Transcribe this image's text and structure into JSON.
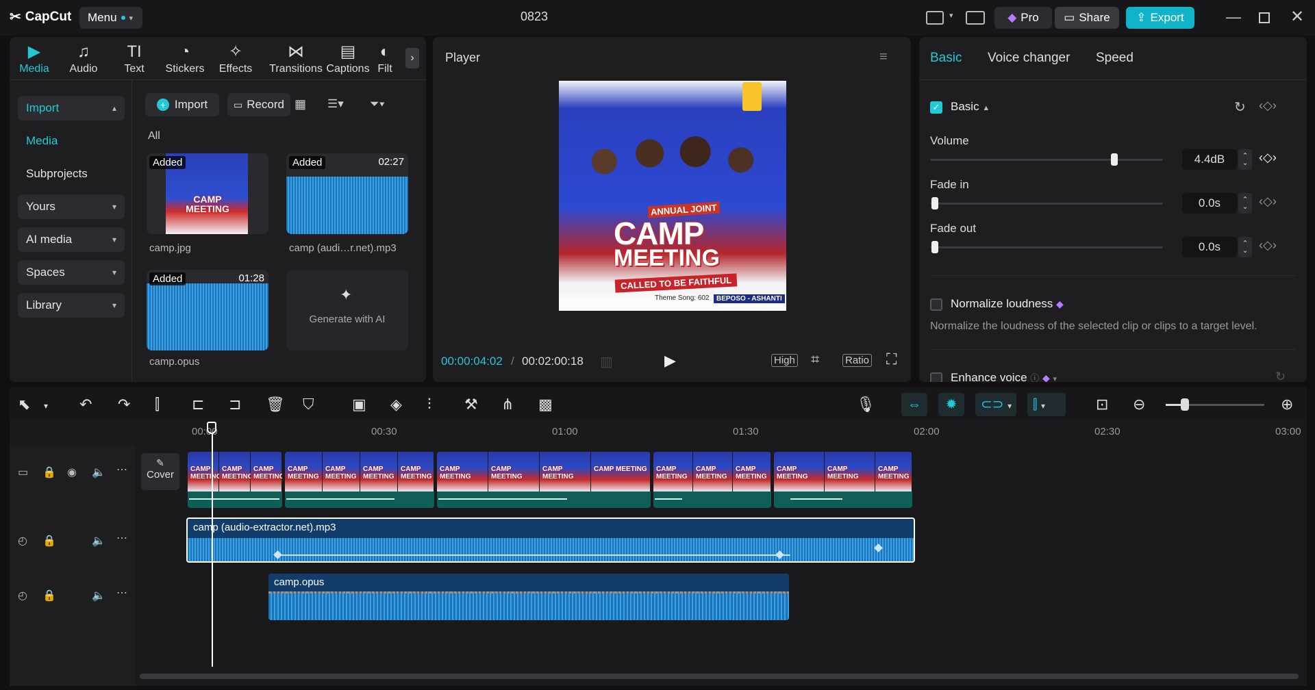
{
  "titlebar": {
    "logo": "CapCut",
    "menu": "Menu",
    "project": "0823",
    "pro": "Pro",
    "share": "Share",
    "export": "Export"
  },
  "media_tabs": [
    {
      "label": "Media",
      "icon": "media-icon"
    },
    {
      "label": "Audio",
      "icon": "audio-icon"
    },
    {
      "label": "Text",
      "icon": "text-icon"
    },
    {
      "label": "Stickers",
      "icon": "sticker-icon"
    },
    {
      "label": "Effects",
      "icon": "effects-icon"
    },
    {
      "label": "Transitions",
      "icon": "transition-icon"
    },
    {
      "label": "Captions",
      "icon": "captions-icon"
    },
    {
      "label": "Filt",
      "icon": "filter-icon"
    }
  ],
  "sidebar": {
    "import": "Import",
    "media": "Media",
    "subprojects": "Subprojects",
    "yours": "Yours",
    "ai_media": "AI media",
    "spaces": "Spaces",
    "library": "Library"
  },
  "media_toolbar": {
    "import": "Import",
    "record": "Record",
    "filter_all": "All"
  },
  "media_items": [
    {
      "name": "camp.jpg",
      "badge": "Added",
      "duration": ""
    },
    {
      "name": "camp (audi…r.net).mp3",
      "badge": "Added",
      "duration": "02:27"
    },
    {
      "name": "camp.opus",
      "badge": "Added",
      "duration": "01:28"
    }
  ],
  "generate_ai": "Generate with AI",
  "player": {
    "title": "Player",
    "current_time": "00:00:04:02",
    "total_time": "00:02:00:18",
    "quality": "High",
    "ratio": "Ratio",
    "poster": {
      "line1": "ANNUAL JOINT",
      "line2": "CAMP",
      "line3": "MEETING",
      "line4": "CALLED TO BE FAITHFUL",
      "theme": "Theme Song: 602",
      "place": "BEPOSO - ASHANTI"
    }
  },
  "inspector": {
    "tabs": [
      "Basic",
      "Voice changer",
      "Speed"
    ],
    "section": "Basic",
    "volume_label": "Volume",
    "volume_value": "4.4dB",
    "volume_level": 0.79,
    "fade_in_label": "Fade in",
    "fade_in_value": "0.0s",
    "fade_out_label": "Fade out",
    "fade_out_value": "0.0s",
    "normalize_label": "Normalize loudness",
    "normalize_desc": "Normalize the loudness of the selected clip or clips to a target level.",
    "enhance_label": "Enhance voice"
  },
  "timeline": {
    "ruler": [
      "00:00",
      "00:30",
      "01:00",
      "01:30",
      "02:00",
      "02:30",
      "03:00"
    ],
    "cover": "Cover",
    "audio_clip_1": "camp (audio-extractor.net).mp3",
    "audio_clip_2": "camp.opus",
    "poster_mini": "CAMP MEETING"
  },
  "colors": {
    "accent": "#22c9d6",
    "export": "#10b3c8",
    "video_track": "#0f5e58",
    "audio_clip": "#123c6a"
  }
}
